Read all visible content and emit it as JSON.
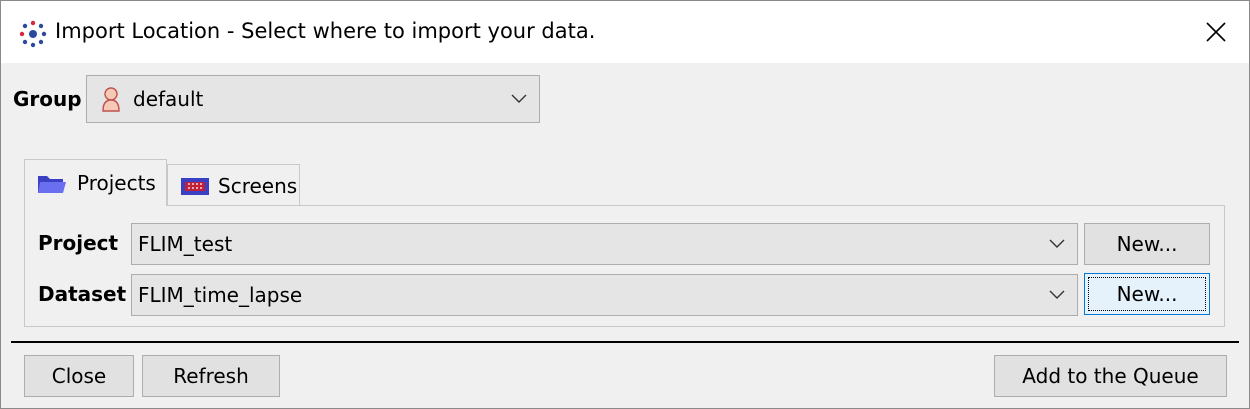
{
  "window": {
    "title": "Import Location - Select where to import your data.",
    "close_icon": "close-icon",
    "app_icon": "omero-logo-icon"
  },
  "group": {
    "label": "Group",
    "selected": "default",
    "icon": "user-icon"
  },
  "tabs": [
    {
      "label": "Projects",
      "icon": "folder-icon",
      "active": true
    },
    {
      "label": "Screens",
      "icon": "screen-plate-icon",
      "active": false
    }
  ],
  "projects_panel": {
    "project_label": "Project",
    "project_value": "FLIM_test",
    "project_new": "New...",
    "dataset_label": "Dataset",
    "dataset_value": "FLIM_time_lapse",
    "dataset_new": "New..."
  },
  "footer": {
    "close": "Close",
    "refresh": "Refresh",
    "add": "Add to the Queue"
  },
  "colors": {
    "accent": "#0078d7",
    "titlebar": "#ffffff",
    "background": "#f0f0f0"
  }
}
